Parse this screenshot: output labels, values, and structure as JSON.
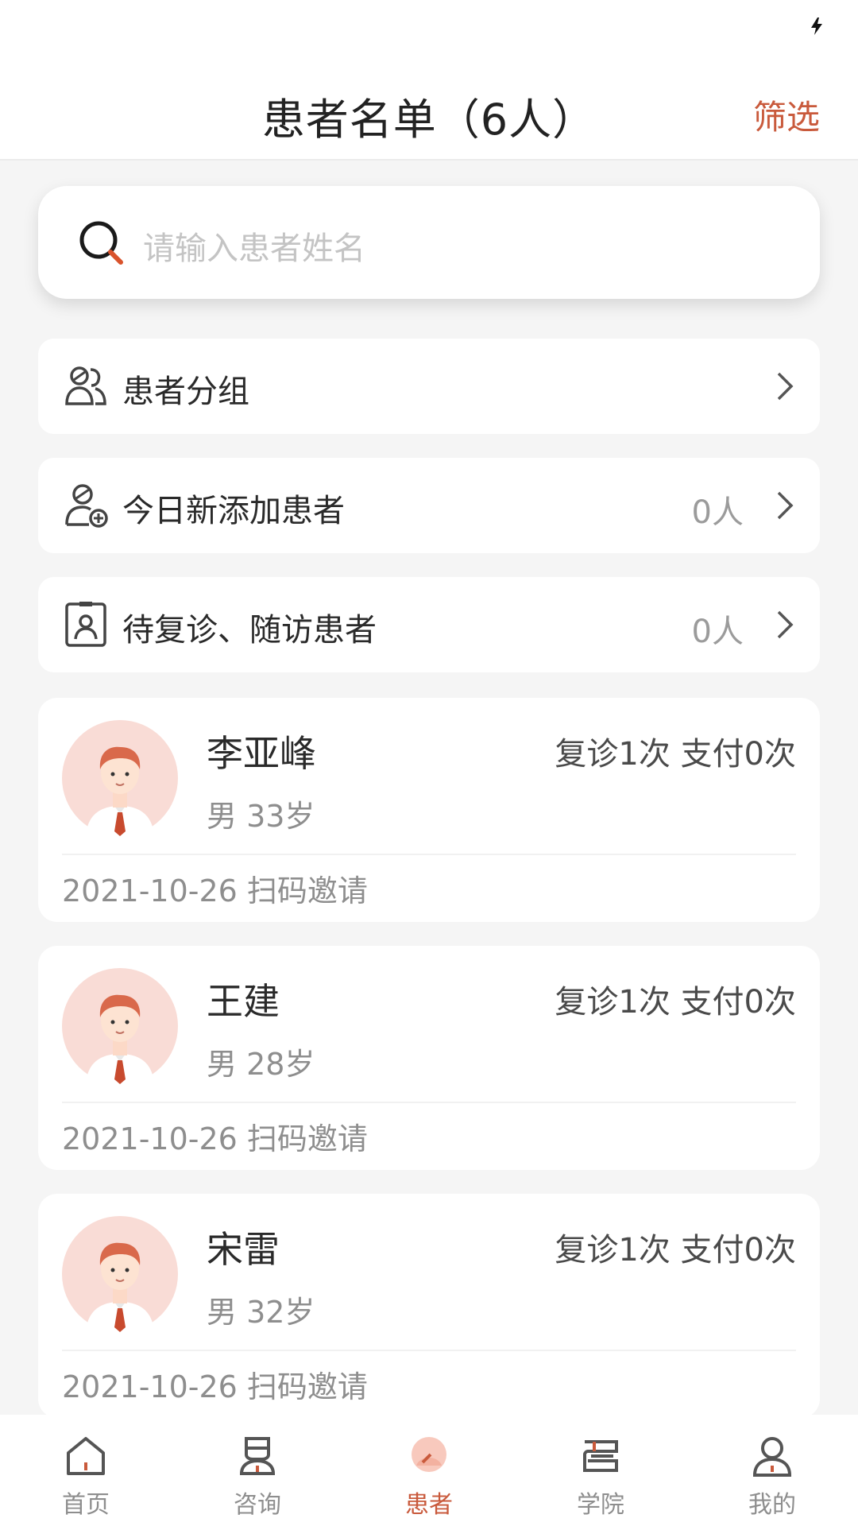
{
  "header": {
    "title": "患者名单（6人）",
    "filter_label": "筛选"
  },
  "search": {
    "placeholder": "请输入患者姓名"
  },
  "menu": [
    {
      "label": "患者分组",
      "count": "",
      "icon": "users-group-icon"
    },
    {
      "label": "今日新添加患者",
      "count": "0人",
      "icon": "add-user-icon"
    },
    {
      "label": "待复诊、随访患者",
      "count": "0人",
      "icon": "patient-card-icon"
    }
  ],
  "patients": [
    {
      "name": "李亚峰",
      "visits": "复诊1次 支付0次",
      "meta": "男 33岁",
      "footer": "2021-10-26 扫码邀请"
    },
    {
      "name": "王建",
      "visits": "复诊1次 支付0次",
      "meta": "男 28岁",
      "footer": "2021-10-26 扫码邀请"
    },
    {
      "name": "宋雷",
      "visits": "复诊1次 支付0次",
      "meta": "男 32岁",
      "footer": "2021-10-26 扫码邀请"
    }
  ],
  "tabs": [
    {
      "label": "首页",
      "icon": "home-icon"
    },
    {
      "label": "咨询",
      "icon": "consult-icon"
    },
    {
      "label": "患者",
      "icon": "patient-icon"
    },
    {
      "label": "学院",
      "icon": "academy-icon"
    },
    {
      "label": "我的",
      "icon": "profile-icon"
    }
  ],
  "colors": {
    "accent": "#c95a3c",
    "background": "#f5f5f5"
  }
}
